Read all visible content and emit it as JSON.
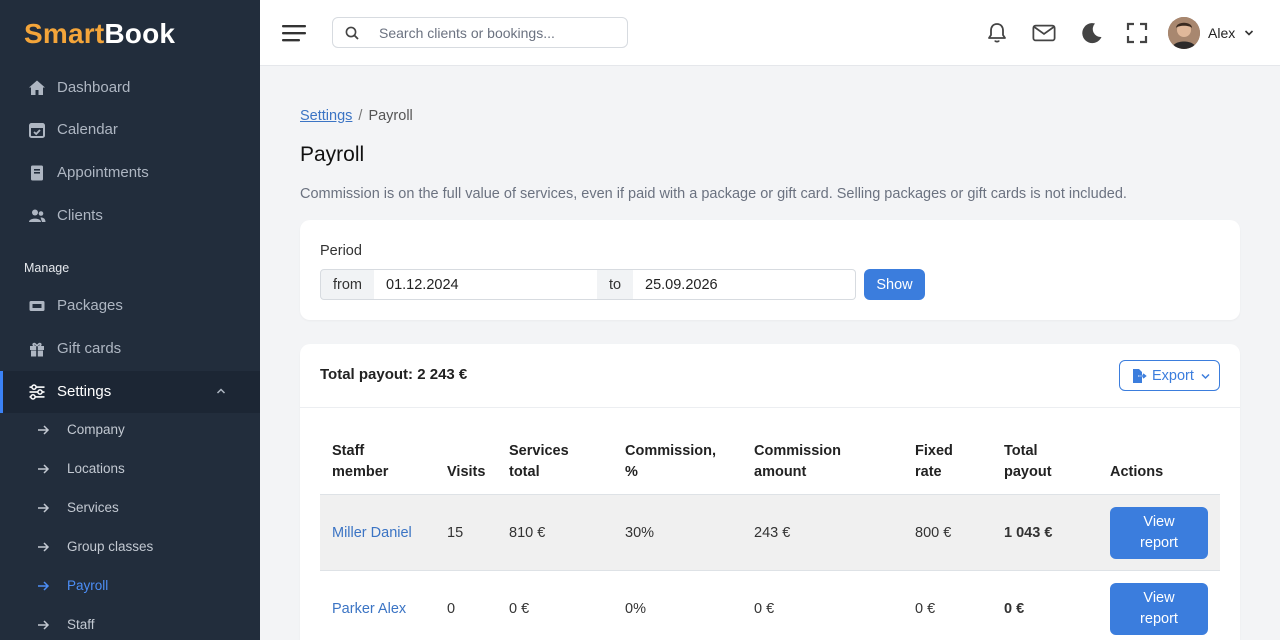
{
  "brand": {
    "part1": "Smart",
    "part2": "Book"
  },
  "sidebar": {
    "items": [
      {
        "label": "Dashboard",
        "icon": "home-icon"
      },
      {
        "label": "Calendar",
        "icon": "calendar-check-icon"
      },
      {
        "label": "Appointments",
        "icon": "book-icon"
      },
      {
        "label": "Clients",
        "icon": "users-icon"
      }
    ],
    "section_label": "Manage",
    "manage_items": [
      {
        "label": "Packages",
        "icon": "ticket-icon"
      },
      {
        "label": "Gift cards",
        "icon": "gift-icon"
      },
      {
        "label": "Settings",
        "icon": "sliders-icon",
        "active": true
      }
    ],
    "settings_sub": [
      {
        "label": "Company"
      },
      {
        "label": "Locations"
      },
      {
        "label": "Services"
      },
      {
        "label": "Group classes"
      },
      {
        "label": "Payroll",
        "active": true
      },
      {
        "label": "Staff"
      }
    ]
  },
  "topbar": {
    "search_placeholder": "Search clients or bookings...",
    "user_name": "Alex"
  },
  "breadcrumb": {
    "parent": "Settings",
    "separator": "/",
    "current": "Payroll"
  },
  "page": {
    "title": "Payroll",
    "description": "Commission is on the full value of services, even if paid with a package or gift card. Selling packages or gift cards is not included."
  },
  "period": {
    "label": "Period",
    "from_label": "from",
    "from_value": "01.12.2024",
    "to_label": "to",
    "to_value": "25.09.2026",
    "show_button": "Show"
  },
  "payroll": {
    "total_label": "Total payout: 2 243 €",
    "export_button": "Export",
    "columns": {
      "staff": [
        "Staff",
        "member"
      ],
      "visits": "Visits",
      "services": [
        "Services",
        "total"
      ],
      "commission_pct": [
        "Commission,",
        "%"
      ],
      "commission_amt": [
        "Commission",
        "amount"
      ],
      "fixed": [
        "Fixed",
        "rate"
      ],
      "total": [
        "Total",
        "payout"
      ],
      "actions": "Actions"
    },
    "rows": [
      {
        "name": "Miller Daniel",
        "visits": "15",
        "services": "810 €",
        "pct": "30%",
        "amount": "243 €",
        "fixed": "800 €",
        "total": "1 043 €",
        "action": [
          "View",
          "report"
        ]
      },
      {
        "name": "Parker Alex",
        "visits": "0",
        "services": "0 €",
        "pct": "0%",
        "amount": "0 €",
        "fixed": "0 €",
        "total": "0 €",
        "action": [
          "View",
          "report"
        ]
      }
    ]
  },
  "colors": {
    "sidebar_bg": "#222d3c",
    "brand_orange": "#f4a53a",
    "accent_blue": "#3b7ddd",
    "link_blue": "#3b74c4"
  }
}
